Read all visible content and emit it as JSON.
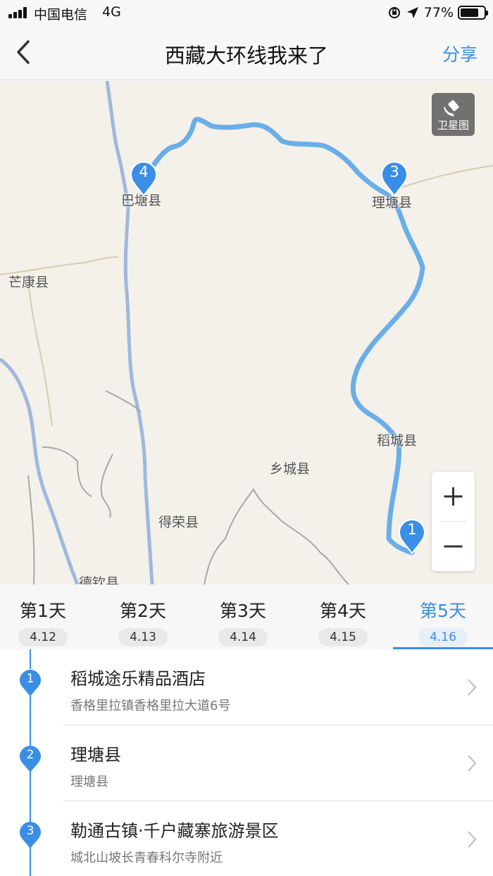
{
  "status_bar": {
    "carrier": "中国电信",
    "network": "4G",
    "battery": "77%",
    "battery_level": 0.77
  },
  "nav": {
    "title": "西藏大环线我来了",
    "share": "分享"
  },
  "map": {
    "satellite_label": "卫星图",
    "labels": {
      "batang": "巴塘县",
      "litang": "理塘县",
      "mangkang": "芒康县",
      "daocheng": "稻城县",
      "xiangcheng": "乡城县",
      "derong": "得荣县",
      "deqin": "德钦县"
    },
    "pins": {
      "p1": "1",
      "p3": "3",
      "p4": "4"
    },
    "route_color": "#6aaee8",
    "pin_color": "#3a8ee6"
  },
  "tabs": [
    {
      "label": "第1天",
      "date": "4.12"
    },
    {
      "label": "第2天",
      "date": "4.13"
    },
    {
      "label": "第3天",
      "date": "4.14"
    },
    {
      "label": "第4天",
      "date": "4.15"
    },
    {
      "label": "第5天",
      "date": "4.16"
    }
  ],
  "active_tab": "第5天",
  "stops": [
    {
      "num": "1",
      "name": "稻城途乐精品酒店",
      "address": "香格里拉镇香格里拉大道6号"
    },
    {
      "num": "2",
      "name": "理塘县",
      "address": "理塘县"
    },
    {
      "num": "3",
      "name": "勒通古镇·千户藏寨旅游景区",
      "address": "城北山坡长青春科尔寺附近"
    }
  ],
  "accent_color": "#3a8ee6"
}
